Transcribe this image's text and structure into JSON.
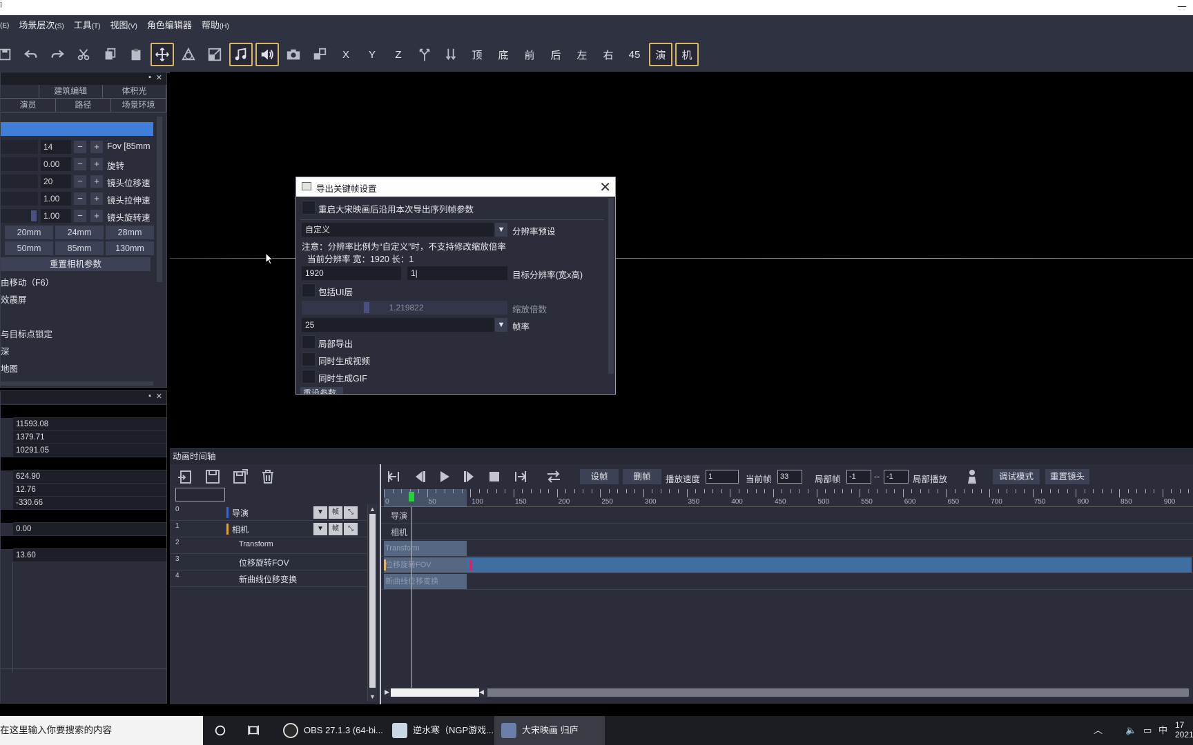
{
  "window": {
    "title_fragment": "ī"
  },
  "menu": [
    {
      "label": "",
      "key": "(E)"
    },
    {
      "label": "场景层次",
      "key": "(S)"
    },
    {
      "label": "工具",
      "key": "(T)"
    },
    {
      "label": "视图",
      "key": "(V)"
    },
    {
      "label": "角色编辑器",
      "key": ""
    },
    {
      "label": "帮助",
      "key": "(H)"
    }
  ],
  "toolbar": {
    "text_buttons": [
      "X",
      "Y",
      "Z",
      "",
      "",
      "顶",
      "底",
      "前",
      "后",
      "左",
      "右",
      "45"
    ],
    "mode_buttons": [
      "演",
      "机"
    ]
  },
  "left_panel": {
    "tabs_row1": [
      "",
      "建筑编辑",
      "体积光"
    ],
    "tabs_row2": [
      "演员",
      "路径",
      "场景环境"
    ],
    "params": [
      {
        "value": "14",
        "label": "Fov [85mm"
      },
      {
        "value": "0.00",
        "label": "旋转"
      },
      {
        "value": "20",
        "label": "镜头位移速"
      },
      {
        "value": "1.00",
        "label": "镜头拉伸速"
      },
      {
        "value": "1.00",
        "label": "镜头旋转速"
      }
    ],
    "lens_row1": [
      "20mm",
      "24mm",
      "28mm"
    ],
    "lens_row2": [
      "50mm",
      "85mm",
      "130mm"
    ],
    "reset_label": "重置相机参数",
    "options": [
      "由移动（F6）",
      "效震屏",
      "与目标点锁定",
      "深",
      "地图"
    ]
  },
  "props_panel": {
    "values": [
      "11593.08",
      "1379.71",
      "10291.05",
      "",
      "624.90",
      "12.76",
      "-330.66",
      "",
      "0.00",
      "",
      "13.60"
    ]
  },
  "dialog": {
    "title": "导出关键帧设置",
    "remember_label": "重启大宋映画后沿用本次导出序列帧参数",
    "preset_value": "自定义",
    "preset_label": "分辨率预设",
    "note": "注意：分辨率比例为“自定义”时，不支持修改缩放倍率",
    "current_res": "当前分辨率 宽：1920 长：1",
    "width_value": "1920",
    "height_value": "1|",
    "target_label": "目标分辨率(宽x高)",
    "include_ui_label": "包括UI层",
    "scale_value": "1.219822",
    "scale_label": "缩放倍数",
    "fps_value": "25",
    "fps_label": "帧率",
    "partial_label": "局部导出",
    "video_label": "同时生成视频",
    "gif_label": "同时生成GIF",
    "reset_btn": "重设参数"
  },
  "timeline": {
    "title": "动画时间轴",
    "set_frame": "设帧",
    "del_frame": "删帧",
    "speed_label": "播放速度",
    "speed_value": "1",
    "current_label": "当前帧",
    "current_value": "33",
    "partial_label": "局部帧",
    "partial_from": "-1",
    "partial_sep": "--",
    "partial_to": "-1",
    "partial_play": "局部播放",
    "debug_mode": "调试模式",
    "reset_cam": "重置镜头",
    "ruler_labels": [
      "0",
      "50",
      "100",
      "150",
      "200",
      "250",
      "300",
      "350",
      "400",
      "450",
      "500",
      "550",
      "600",
      "650",
      "700",
      "750",
      "800",
      "850",
      "900"
    ],
    "tracks": [
      {
        "idx": "0",
        "name": "导演",
        "color": "#3f63c6",
        "lane": "导演"
      },
      {
        "idx": "1",
        "name": "相机",
        "color": "#d7a93c",
        "lane": "相机"
      },
      {
        "idx": "2",
        "name": "Transform",
        "lane": "Transform"
      },
      {
        "idx": "3",
        "name": "位移旋转FOV",
        "lane": "位移旋转FOV"
      },
      {
        "idx": "4",
        "name": "新曲线位移变换",
        "lane": "新曲线位移变换"
      }
    ],
    "frame_btn": "帧"
  },
  "taskbar": {
    "search_placeholder": "在这里输入你要搜索的内容",
    "apps": [
      "OBS 27.1.3 (64-bi...",
      "逆水寒（NGP游戏...",
      "大宋映画 归庐"
    ],
    "ime": "中",
    "clock_top": "17",
    "clock_bottom": "2021"
  }
}
